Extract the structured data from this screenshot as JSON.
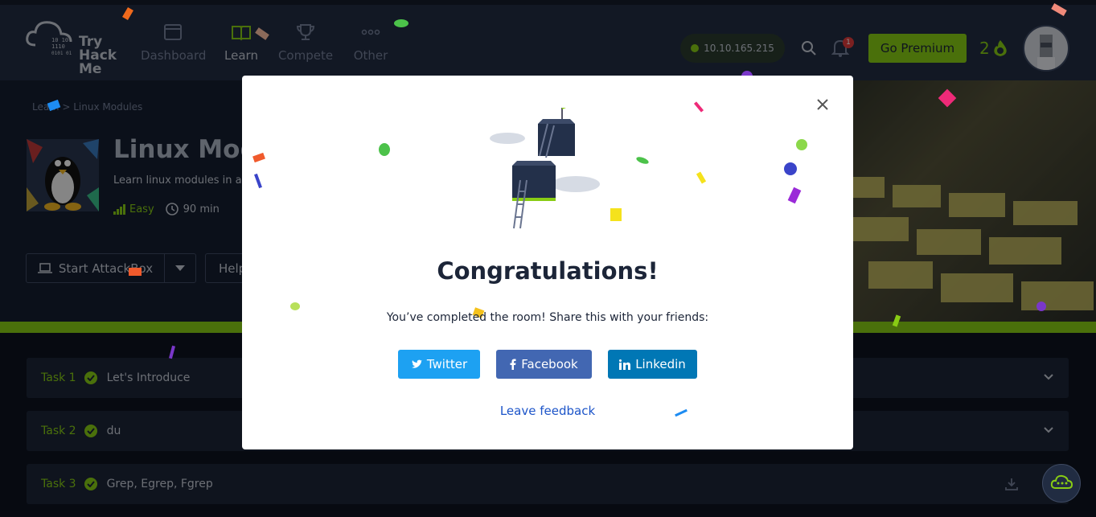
{
  "nav": {
    "logo_text": [
      "Try",
      "Hack",
      "Me"
    ],
    "items": [
      {
        "label": "Dashboard",
        "icon": "dashboard-icon"
      },
      {
        "label": "Learn",
        "icon": "book-icon"
      },
      {
        "label": "Compete",
        "icon": "trophy-icon"
      },
      {
        "label": "Other",
        "icon": "more-icon"
      }
    ],
    "ip_address": "10.10.165.215",
    "notification_count": "1",
    "premium_label": "Go Premium",
    "streak": "2"
  },
  "hero": {
    "breadcrumb_home": "Learn",
    "breadcrumb_current": "Linux Modules",
    "title": "Linux Modu",
    "description": "Learn linux modules in a",
    "difficulty": "Easy",
    "duration": "90 min",
    "attackbox_label": "Start AttackBox",
    "help_label": "Help"
  },
  "tasks": [
    {
      "num": "Task 1",
      "title": "Let's Introduce"
    },
    {
      "num": "Task 2",
      "title": "du"
    },
    {
      "num": "Task 3",
      "title": "Grep, Egrep, Fgrep"
    }
  ],
  "modal": {
    "title": "Congratulations!",
    "share_text": "You’ve completed the room! Share this with your friends:",
    "twitter_label": "Twitter",
    "facebook_label": "Facebook",
    "linkedin_label": "Linkedin",
    "feedback_label": "Leave feedback"
  },
  "colors": {
    "accent": "#88cc14",
    "twitter": "#1da1f2",
    "facebook": "#4267b2",
    "linkedin": "#0077b5"
  }
}
